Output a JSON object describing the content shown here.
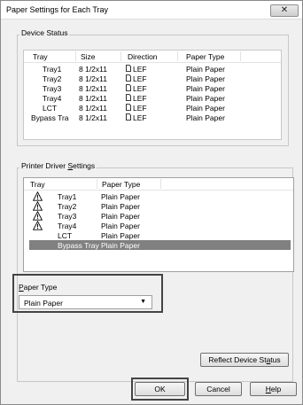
{
  "window": {
    "title": "Paper Settings for Each Tray",
    "close_glyph": "✕"
  },
  "device_status": {
    "label": "Device Status",
    "columns": [
      "Tray",
      "Size",
      "Direction",
      "Paper Type"
    ],
    "rows": [
      {
        "tray": "Tray1",
        "size": "8 1/2x11",
        "direction": "LEF",
        "paper_type": "Plain Paper"
      },
      {
        "tray": "Tray2",
        "size": "8 1/2x11",
        "direction": "LEF",
        "paper_type": "Plain Paper"
      },
      {
        "tray": "Tray3",
        "size": "8 1/2x11",
        "direction": "LEF",
        "paper_type": "Plain Paper"
      },
      {
        "tray": "Tray4",
        "size": "8 1/2x11",
        "direction": "LEF",
        "paper_type": "Plain Paper"
      },
      {
        "tray": "LCT",
        "size": "8 1/2x11",
        "direction": "LEF",
        "paper_type": "Plain Paper"
      },
      {
        "tray": "Bypass Tra",
        "size": "8 1/2x11",
        "direction": "LEF",
        "paper_type": "Plain Paper"
      }
    ],
    "direction_icon": "portrait-page-icon"
  },
  "driver_settings": {
    "label_pre": "Printer Driver ",
    "label_accel": "S",
    "label_post": "ettings",
    "columns": [
      "Tray",
      "Paper Type"
    ],
    "rows": [
      {
        "tray": "Tray1",
        "paper_type": "Plain Paper",
        "icon": "warning-icon"
      },
      {
        "tray": "Tray2",
        "paper_type": "Plain Paper",
        "icon": "warning-icon"
      },
      {
        "tray": "Tray3",
        "paper_type": "Plain Paper",
        "icon": "warning-icon"
      },
      {
        "tray": "Tray4",
        "paper_type": "Plain Paper",
        "icon": "warning-icon"
      },
      {
        "tray": "LCT",
        "paper_type": "Plain Paper",
        "icon": ""
      },
      {
        "tray": "Bypass Tray",
        "paper_type": "Plain Paper",
        "icon": "",
        "selected": true
      }
    ]
  },
  "paper_type": {
    "label_accel": "P",
    "label_post": "aper Type",
    "selected_value": "Plain Paper"
  },
  "buttons": {
    "reflect_pre": "Reflect Device St",
    "reflect_accel": "a",
    "reflect_post": "tus",
    "ok": "OK",
    "cancel": "Cancel",
    "help_accel": "H",
    "help_post": "elp"
  },
  "colors": {
    "selection": "#808080",
    "dialog_bg": "#f0f0f0",
    "highlight_border": "#444444"
  }
}
